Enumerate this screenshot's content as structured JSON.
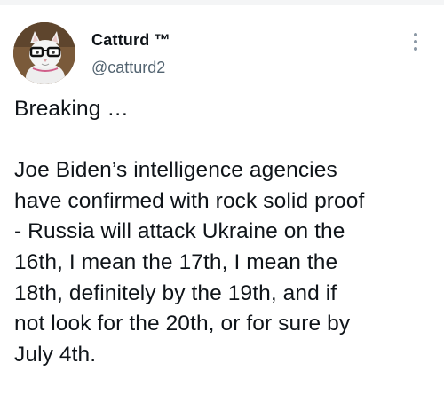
{
  "tweet": {
    "author": {
      "display_name": "Catturd ™",
      "username": "@catturd2",
      "avatar_icon": "cat-avatar-icon"
    },
    "more_icon": "more-vertical-icon",
    "text_lines": [
      "Breaking …",
      "",
      "Joe Biden’s intelligence agencies",
      "have confirmed with rock solid proof",
      "- Russia will attack Ukraine on the",
      "16th, I mean the 17th, I mean the",
      "18th, definitely by the 19th, and if",
      "not look for the 20th, or for sure by",
      "July 4th."
    ]
  },
  "colors": {
    "text": "#0f1419",
    "secondary": "#536471",
    "background": "#ffffff"
  }
}
